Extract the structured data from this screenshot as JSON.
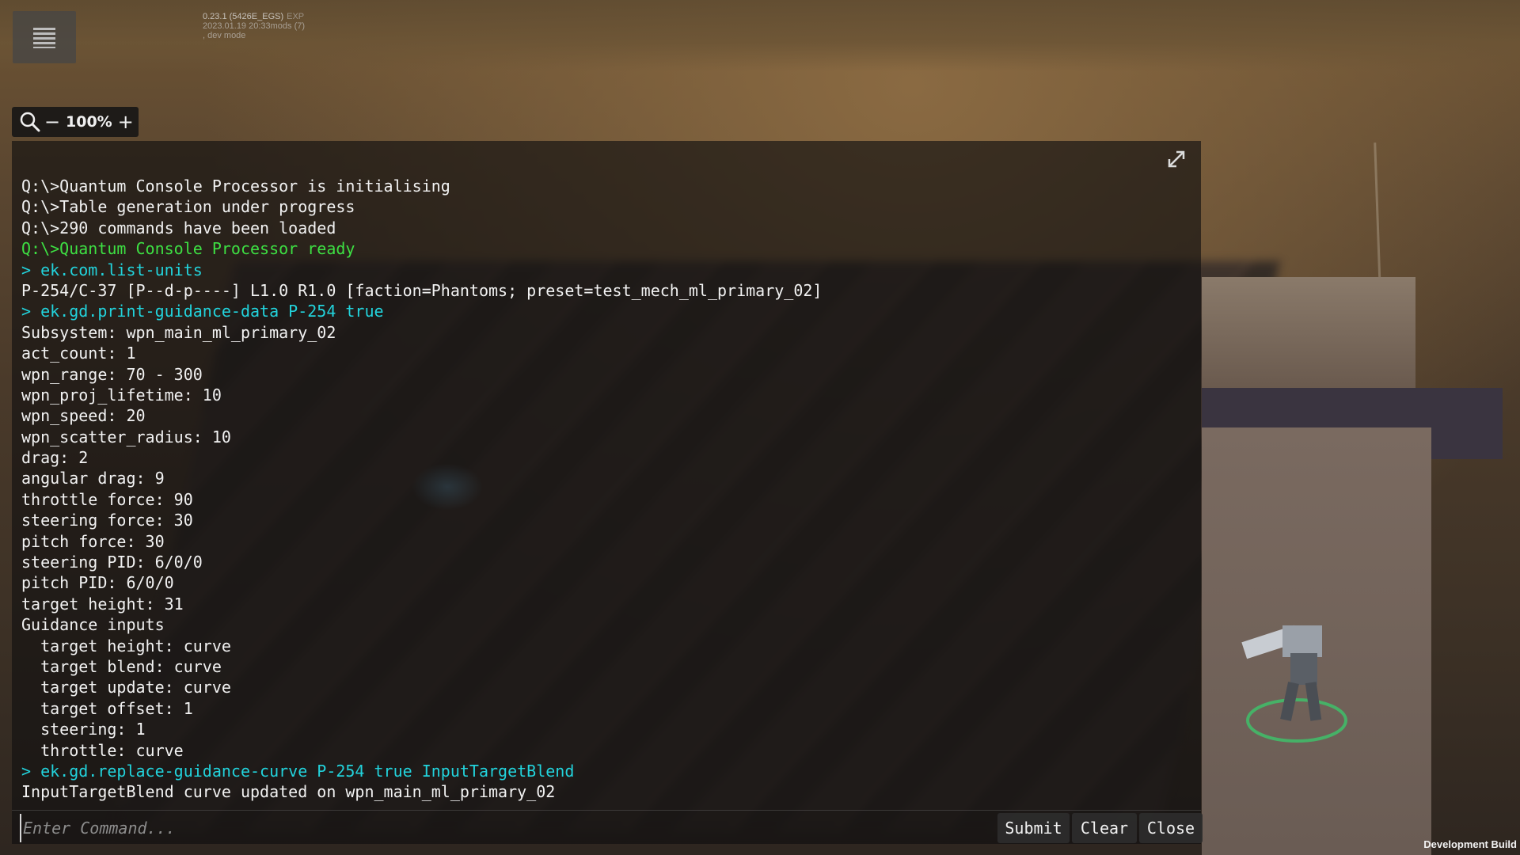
{
  "hud": {
    "build_version": "0.23.1 (5426E_EGS)",
    "build_tag": "EXP",
    "build_date": "2023.01.19 20:33mods (7)",
    "build_mode": ", dev mode",
    "zoom_out": "−",
    "zoom_level": "100%",
    "zoom_in": "+",
    "dev_build_label": "Development Build"
  },
  "console": {
    "lines": [
      {
        "text": "Q:\\>Quantum Console Processor is initialising",
        "kind": "normal"
      },
      {
        "text": "Q:\\>Table generation under progress",
        "kind": "normal"
      },
      {
        "text": "Q:\\>290 commands have been loaded",
        "kind": "normal"
      },
      {
        "text": "Q:\\>Quantum Console Processor ready",
        "kind": "ready"
      },
      {
        "text": "> ek.com.list-units",
        "kind": "cmd"
      },
      {
        "text": "P-254/C-37 [P--d-p----] L1.0 R1.0 [faction=Phantoms; preset=test_mech_ml_primary_02]",
        "kind": "normal"
      },
      {
        "text": "> ek.gd.print-guidance-data P-254 true",
        "kind": "cmd"
      },
      {
        "text": "Subsystem: wpn_main_ml_primary_02",
        "kind": "normal"
      },
      {
        "text": "act_count: 1",
        "kind": "normal"
      },
      {
        "text": "wpn_range: 70 - 300",
        "kind": "normal"
      },
      {
        "text": "wpn_proj_lifetime: 10",
        "kind": "normal"
      },
      {
        "text": "wpn_speed: 20",
        "kind": "normal"
      },
      {
        "text": "wpn_scatter_radius: 10",
        "kind": "normal"
      },
      {
        "text": "drag: 2",
        "kind": "normal"
      },
      {
        "text": "angular drag: 9",
        "kind": "normal"
      },
      {
        "text": "throttle force: 90",
        "kind": "normal"
      },
      {
        "text": "steering force: 30",
        "kind": "normal"
      },
      {
        "text": "pitch force: 30",
        "kind": "normal"
      },
      {
        "text": "steering PID: 6/0/0",
        "kind": "normal"
      },
      {
        "text": "pitch PID: 6/0/0",
        "kind": "normal"
      },
      {
        "text": "target height: 31",
        "kind": "normal"
      },
      {
        "text": "Guidance inputs",
        "kind": "normal"
      },
      {
        "text": "  target height: curve",
        "kind": "normal"
      },
      {
        "text": "  target blend: curve",
        "kind": "normal"
      },
      {
        "text": "  target update: curve",
        "kind": "normal"
      },
      {
        "text": "  target offset: 1",
        "kind": "normal"
      },
      {
        "text": "  steering: 1",
        "kind": "normal"
      },
      {
        "text": "  throttle: curve",
        "kind": "normal"
      },
      {
        "text": "> ek.gd.replace-guidance-curve P-254 true InputTargetBlend",
        "kind": "cmd"
      },
      {
        "text": "InputTargetBlend curve updated on wpn_main_ml_primary_02",
        "kind": "normal"
      }
    ],
    "input_placeholder": "Enter Command...",
    "input_value": "",
    "submit_label": "Submit",
    "clear_label": "Clear",
    "close_label": "Close"
  },
  "colors": {
    "ready": "#3de043",
    "command": "#22d3dc",
    "text": "#f2f2f2"
  }
}
